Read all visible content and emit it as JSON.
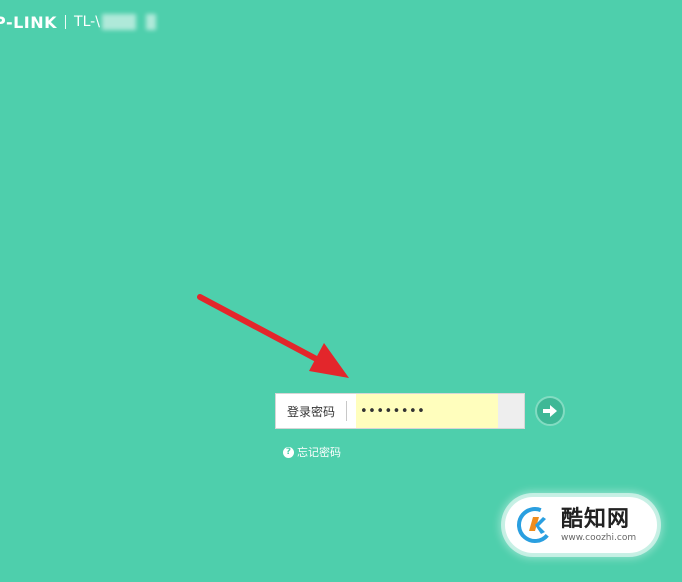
{
  "header": {
    "logo_text": "P-LINK",
    "model_text": "TL-\\"
  },
  "login": {
    "password_label": "登录密码",
    "password_value": "••••••••",
    "submit_icon": "arrow-right-icon",
    "forgot_icon": "question-circle-icon",
    "forgot_label": "忘记密码"
  },
  "annotation": {
    "arrow_color": "#e3262b"
  },
  "watermark": {
    "title": "酷知网",
    "url": "www.coozhi.com"
  },
  "colors": {
    "background": "#4ecfac",
    "input_highlight": "#fffebd",
    "button": "#3eb896"
  }
}
